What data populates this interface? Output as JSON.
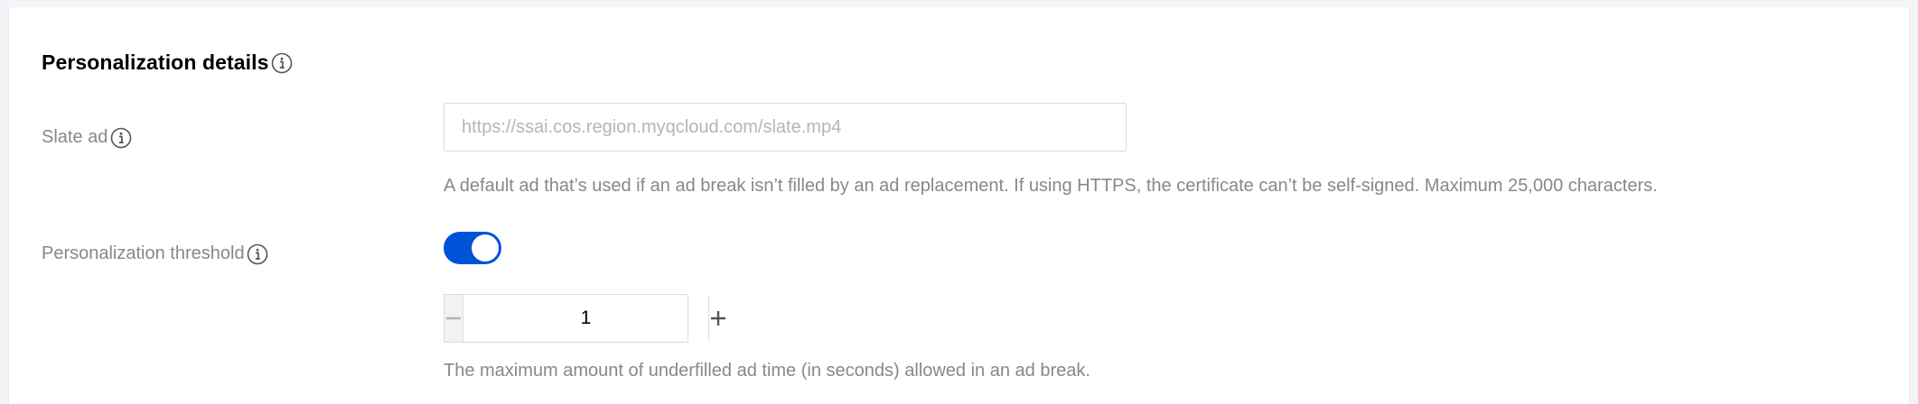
{
  "section": {
    "title": "Personalization details"
  },
  "slate_ad": {
    "label": "Slate ad",
    "placeholder": "https://ssai.cos.region.myqcloud.com/slate.mp4",
    "value": "",
    "help": "A default ad that’s used if an ad break isn’t filled by an ad replacement. If using HTTPS, the certificate can’t be self-signed. Maximum 25,000 characters."
  },
  "threshold": {
    "label": "Personalization threshold",
    "enabled": true,
    "value": "1",
    "help": "The maximum amount of underfilled ad time (in seconds) allowed in an ad break."
  },
  "colors": {
    "accent": "#0052d9",
    "label": "#888888",
    "border": "#dcdcdc"
  }
}
